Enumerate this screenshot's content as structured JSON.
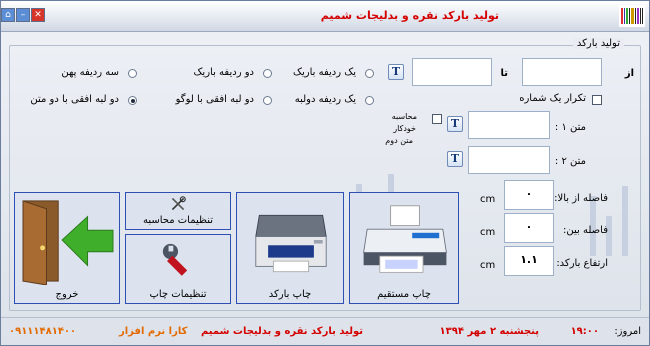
{
  "window": {
    "title": "تولید بارکد نقره و بدلیجات شمیم",
    "close_glyph": "✕",
    "minimize_glyph": "–",
    "restore_glyph": "⌂"
  },
  "group": {
    "title": "تولید بارکد"
  },
  "range": {
    "from_label": "از",
    "to_label": "تا",
    "from_value": "",
    "to_value": "",
    "repeat_label": "تکرار یک شماره",
    "repeat_checked": false
  },
  "layout_options": [
    {
      "label": "یک ردیفه باریک",
      "selected": false
    },
    {
      "label": "دو ردیفه باریک",
      "selected": false
    },
    {
      "label": "سه ردیفه پهن",
      "selected": false
    },
    {
      "label": "یک ردیفه دولبه",
      "selected": false
    },
    {
      "label": "دو لبه افقی با لوگو",
      "selected": false
    },
    {
      "label": "دو لبه افقی با دو متن",
      "selected": true
    }
  ],
  "text1": {
    "label": "متن ۱ :",
    "value": "",
    "auto_calc_label_1": "محاسبه",
    "auto_calc_label_2": "خودکار",
    "auto_calc_label_3": "متن دوم",
    "auto_calc_checked": false
  },
  "text2": {
    "label": "متن ۲ :",
    "value": ""
  },
  "fields": {
    "top_label": "فاصله از بالا:",
    "top_value": "۰",
    "gap_label": "فاصله بین:",
    "gap_value": "۰",
    "height_label": "ارتفاع بارکد:",
    "height_value": "۱.۱",
    "unit": "cm"
  },
  "buttons": {
    "print_direct": "چاپ مستقیم",
    "print_barcode": "چاپ بارکد",
    "print_settings": "تنظیمات چاپ",
    "calc_settings": "تنظیمات محاسبه",
    "exit": "خروج"
  },
  "status": {
    "today_label": "امروز:",
    "time": "۱۹:۰۰",
    "date": "پنجشنبه ۲ مهر ۱۳۹۴",
    "app_name": "تولید بارکد نقره و بدلیجات شمیم",
    "vendor": "کارا نرم افزار",
    "phone": "۰۹۱۱۱۴۸۱۴۰۰"
  },
  "colors": {
    "title_red": "#d40000",
    "accent_orange": "#e46a00",
    "button_border": "#2f4fb5",
    "arrow_green": "#3fae2a"
  },
  "icons": [
    "barcode-logo-icon",
    "close-icon",
    "minimize-icon",
    "restore-icon",
    "text-format-icon",
    "printer-icon",
    "barcode-printer-icon",
    "wrench-icon",
    "tools-icon",
    "exit-door-icon"
  ]
}
